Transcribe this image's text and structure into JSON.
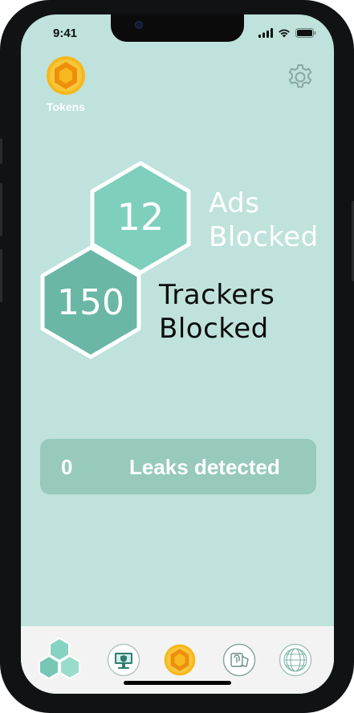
{
  "status_bar": {
    "time": "9:41",
    "icons": [
      "cellular-signal-icon",
      "wifi-icon",
      "battery-icon"
    ]
  },
  "header": {
    "tokens_label": "Tokens",
    "tokens_icon": "token-coin-icon",
    "settings_icon": "gear-icon"
  },
  "stats": {
    "ads_count": "12",
    "ads_label_line1": "Ads",
    "ads_label_line2": "Blocked",
    "trackers_count": "150",
    "trackers_label_line1": "Trackers",
    "trackers_label_line2": "Blocked"
  },
  "leaks": {
    "count": "0",
    "label": "Leaks detected"
  },
  "tab_bar": {
    "items": [
      {
        "icon": "hexagon-cluster-icon",
        "selected": true
      },
      {
        "icon": "secure-monitor-icon",
        "selected": false
      },
      {
        "icon": "token-coin-icon",
        "selected": false
      },
      {
        "icon": "fingerprint-card-icon",
        "selected": false
      },
      {
        "icon": "globe-icon",
        "selected": false
      }
    ]
  },
  "colors": {
    "screen_background": "#bfe2dc",
    "hex_ads_fill": "#7fcfbd",
    "hex_trackers_fill": "#6ab7a6",
    "leaks_panel": "#97c9bd",
    "coin_gold": "#f6b81c",
    "tab_bar": "#f3f3f3"
  }
}
